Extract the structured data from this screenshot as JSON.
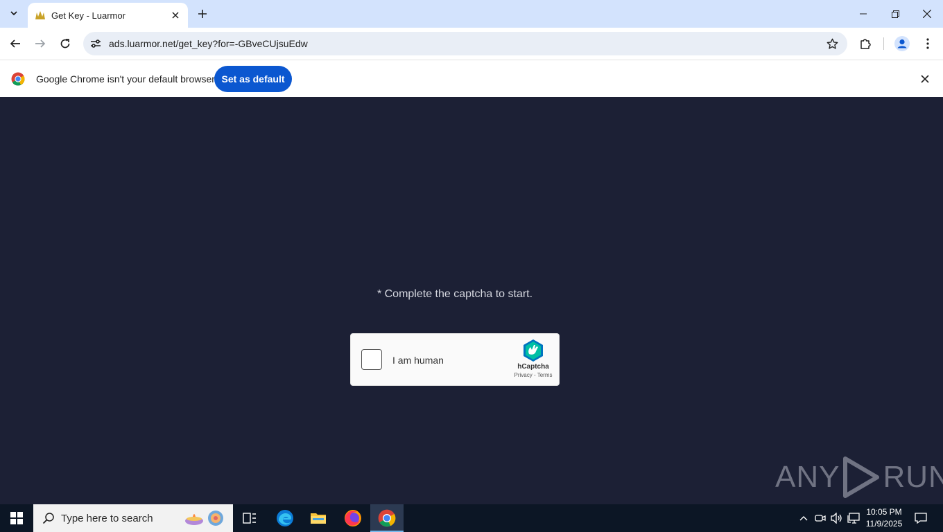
{
  "browser": {
    "tab": {
      "title": "Get Key - Luarmor"
    },
    "url": "ads.luarmor.net/get_key?for=-GBveCUjsuEdw"
  },
  "infobar": {
    "message": "Google Chrome isn't your default browser",
    "button": "Set as default"
  },
  "page": {
    "prompt": "* Complete the captcha to start.",
    "captcha": {
      "label": "I am human",
      "brand": "hCaptcha",
      "links": "Privacy - Terms"
    },
    "watermark": {
      "left": "ANY",
      "right": "RUN"
    }
  },
  "taskbar": {
    "search_placeholder": "Type here to search",
    "time": "10:05 PM",
    "date": "11/9/2025"
  },
  "colors": {
    "page_bg": "#1c2035",
    "accent": "#0b57d0",
    "tabstrip": "#d3e3fd"
  }
}
